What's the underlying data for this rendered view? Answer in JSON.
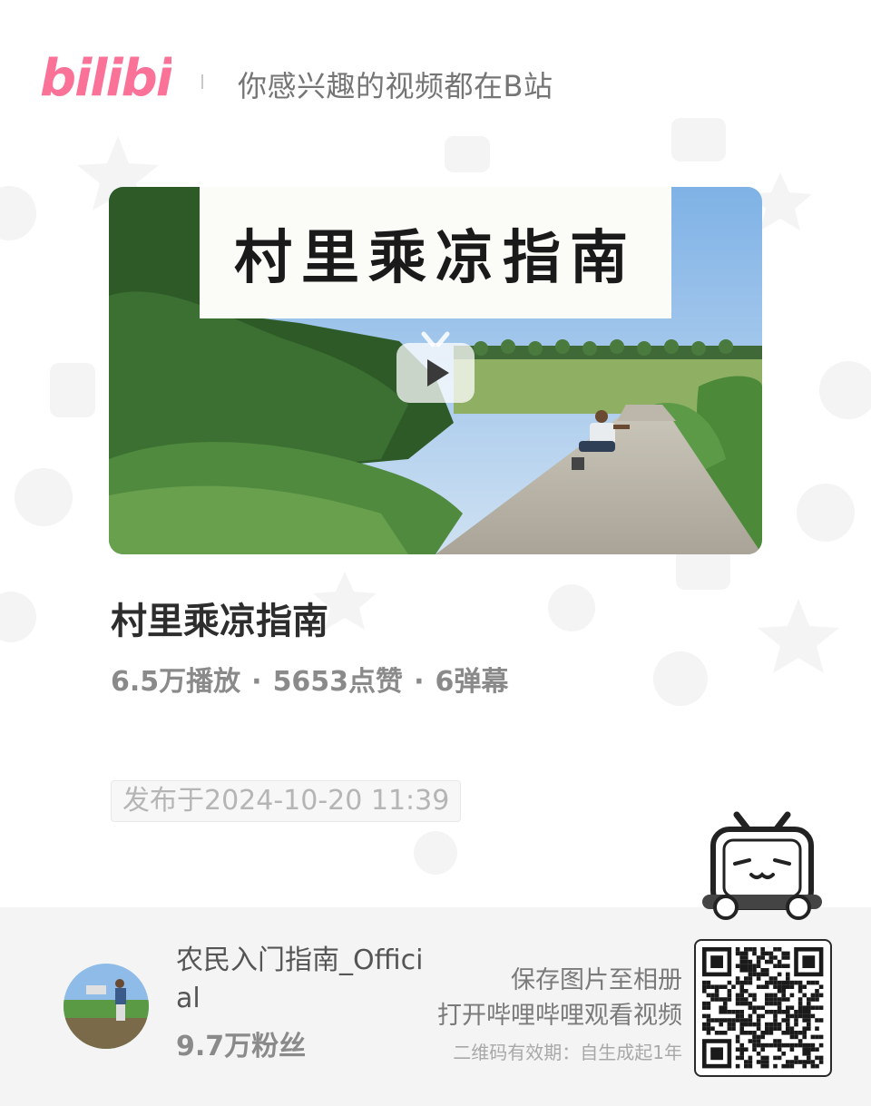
{
  "header": {
    "logo_text": "bilibili",
    "slogan": "你感兴趣的视频都在B站"
  },
  "video": {
    "cover_title": "村里乘凉指南",
    "title": "村里乘凉指南",
    "plays": "6.5万播放",
    "likes": "5653点赞",
    "danmaku": "6弹幕",
    "separator": "·",
    "published": "发布于2024-10-20 11:39"
  },
  "uploader": {
    "name": "农民入门指南_Official",
    "fans": "9.7万粉丝"
  },
  "qr": {
    "save_hint": "保存图片至相册",
    "open_hint": "打开哔哩哔哩观看视频",
    "validity": "二维码有效期：自生成起1年"
  },
  "colors": {
    "brand_pink": "#fb7299",
    "text_dark": "#2d2d2d",
    "text_gray": "#8a8a8a",
    "footer_bg": "#f4f4f4"
  },
  "icons": [
    "bilibili-logo",
    "play-icon",
    "tv-mascot-icon",
    "qr-code"
  ]
}
